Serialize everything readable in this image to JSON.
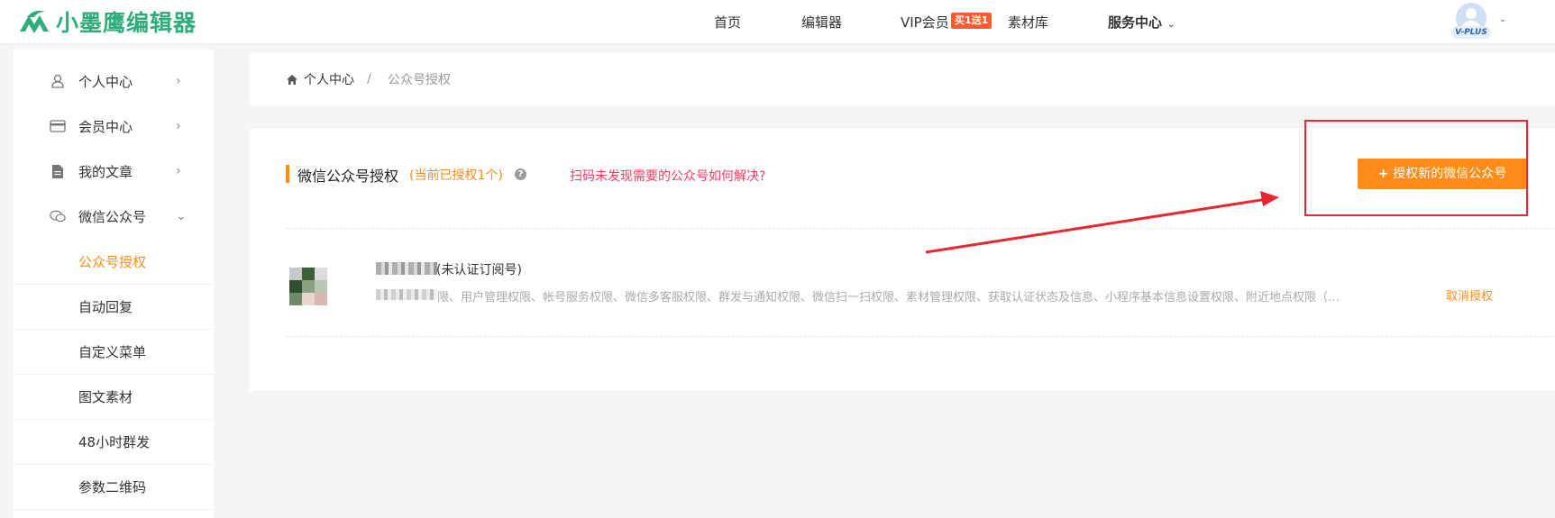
{
  "header": {
    "logo_text": "小墨鹰编辑器",
    "nav": {
      "home": "首页",
      "editor": "编辑器",
      "vip": "VIP会员",
      "vip_badge": "买1送1",
      "materials": "素材库",
      "service": "服务中心"
    },
    "avatar_badge": "V-PLUS"
  },
  "sidebar": {
    "items": [
      {
        "label": "个人中心",
        "icon": "user-icon"
      },
      {
        "label": "会员中心",
        "icon": "card-icon"
      },
      {
        "label": "我的文章",
        "icon": "document-icon"
      },
      {
        "label": "微信公众号",
        "icon": "wechat-icon"
      }
    ],
    "subitems": [
      "公众号授权",
      "自动回复",
      "自定义菜单",
      "图文素材",
      "48小时群发",
      "参数二维码"
    ],
    "active_subitem": "公众号授权"
  },
  "breadcrumb": {
    "home": "个人中心",
    "separator": "/",
    "current": "公众号授权"
  },
  "main": {
    "title": "微信公众号授权",
    "count_text": "(当前已授权1个)",
    "help_icon": "question-icon",
    "help_link": "扫码未发现需要的公众号如何解决?",
    "authorize_button": "授权新的微信公众号",
    "accounts": [
      {
        "type": "(未认证订阅号)",
        "permissions": "限、用户管理权限、帐号服务权限、微信多客服权限、群发与通知权限、微信扫一扫权限、素材管理权限、获取认证状态及信息、小程序基本信息设置权限、附近地点权限（小程...",
        "revoke_label": "取消授权"
      }
    ]
  },
  "colors": {
    "accent": "#ff8c1a",
    "brand": "#2fae7b",
    "link_red": "#ff3b5c",
    "annotation": "#e8272f"
  }
}
